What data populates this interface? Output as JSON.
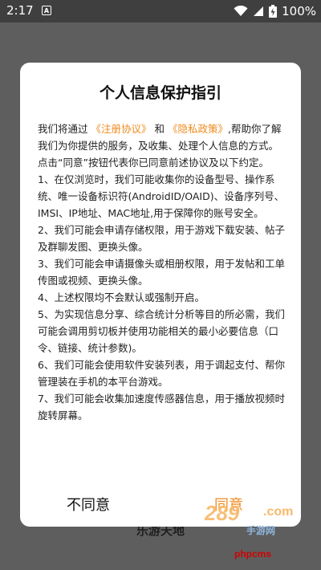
{
  "status_bar": {
    "time": "2:17",
    "notification_letter": "A",
    "battery_percent": "100%",
    "icons": [
      "wifi-icon",
      "signal-icon",
      "battery-icon"
    ]
  },
  "background": {
    "title": "乐游天地",
    "watermark": "phpcms"
  },
  "dialog": {
    "title": "个人信息保护指引",
    "intro_prefix": "我们将通过",
    "link_agreement": "《注册协议》",
    "intro_and": "和",
    "link_privacy": "《隐私政策》",
    "intro_suffix": ",帮助你了解我们为你提供的服务，及收集、处理个人信息的方式。",
    "consent_note": "点击“同意”按钮代表你已同意前述协议及以下约定。",
    "items": [
      "1、在仅浏览时，我们可能收集你的设备型号、操作系统、唯一设备标识符(AndroidID/OAID)、设备序列号、IMSI、IP地址、MAC地址,用于保障你的账号安全。",
      "2、我们可能会申请存储权限，用于游戏下载安装、帖子及群聊发图、更换头像。",
      "3、我们可能会申请摄像头或相册权限，用于发帖和工单传图或视频、更换头像。",
      "4、上述权限均不会默认或强制开启。",
      "5、为实现信息分享、综合统计分析等目的所必需，我们可能会调用剪切板并使用功能相关的最小必要信息（口令、链接、统计参数)。",
      "6、我们可能会使用软件安装列表，用于调起支付、帮你管理装在手机的本平台游戏。",
      "7、我们可能会收集加速度传感器信息，用于播放视频时旋转屏幕。"
    ],
    "disagree_label": "不同意",
    "agree_label": "同意",
    "accent_color": "#f08a1e"
  },
  "watermark": {
    "brand": "289",
    "domain": ".com",
    "subtitle": "手游网"
  }
}
